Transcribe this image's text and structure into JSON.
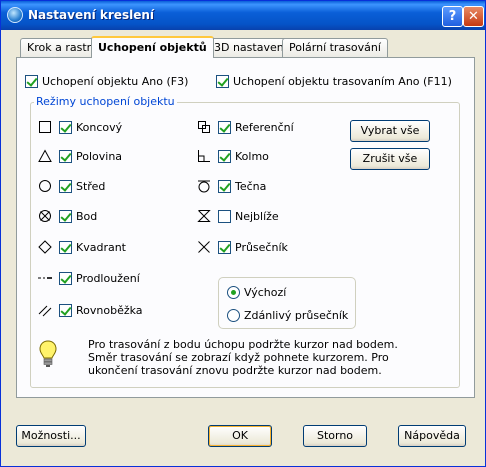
{
  "window": {
    "title": "Nastavení kreslení",
    "help_label": "?",
    "close_label": "✕"
  },
  "tabs": [
    {
      "label": "Krok a rastr",
      "active": false
    },
    {
      "label": "Uchopení objektů",
      "active": true
    },
    {
      "label": "3D nastavení",
      "active": false
    },
    {
      "label": "Polární trasování",
      "active": false
    }
  ],
  "top_checks": {
    "osnap_on": {
      "label": "Uchopení objektu Ano (F3)",
      "checked": true
    },
    "tracking_on": {
      "label": "Uchopení objektu trasovaním Ano (F11)",
      "checked": true
    }
  },
  "group_label": "Režimy uchopení objektu",
  "modes_left": [
    {
      "icon": "endpoint-icon",
      "label": "Koncový",
      "checked": true
    },
    {
      "icon": "midpoint-icon",
      "label": "Polovina",
      "checked": true
    },
    {
      "icon": "center-icon",
      "label": "Střed",
      "checked": true
    },
    {
      "icon": "node-icon",
      "label": "Bod",
      "checked": true
    },
    {
      "icon": "quadrant-icon",
      "label": "Kvadrant",
      "checked": true
    },
    {
      "icon": "extension-icon",
      "label": "Prodloužení",
      "checked": true
    },
    {
      "icon": "parallel-icon",
      "label": "Rovnoběžka",
      "checked": true
    }
  ],
  "modes_right": [
    {
      "icon": "reference-icon",
      "label": "Referenční",
      "checked": true
    },
    {
      "icon": "perpendicular-icon",
      "label": "Kolmo",
      "checked": true
    },
    {
      "icon": "tangent-icon",
      "label": "Tečna",
      "checked": true
    },
    {
      "icon": "nearest-icon",
      "label": "Nejblíže",
      "checked": false
    },
    {
      "icon": "intersection-icon",
      "label": "Průsečník",
      "checked": true
    }
  ],
  "buttons": {
    "select_all": "Vybrat vše",
    "clear_all": "Zrušit vše"
  },
  "intersection_mode": [
    {
      "label": "Výchozí",
      "selected": true
    },
    {
      "label": "Zdánlivý průsečník",
      "selected": false
    }
  ],
  "info_text": "Pro trasování z bodu úchopu podržte kurzor nad bodem.  Směr trasování se zobrazí když pohnete kurzorem.  Pro ukončení trasování znovu podržte kurzor nad bodem.",
  "footer": {
    "options": "Možnosti...",
    "ok": "OK",
    "cancel": "Storno",
    "help": "Nápověda"
  },
  "colors": {
    "title_bar": "#0a5fd8",
    "group_label": "#0046d5",
    "check_mark": "#21a121"
  }
}
